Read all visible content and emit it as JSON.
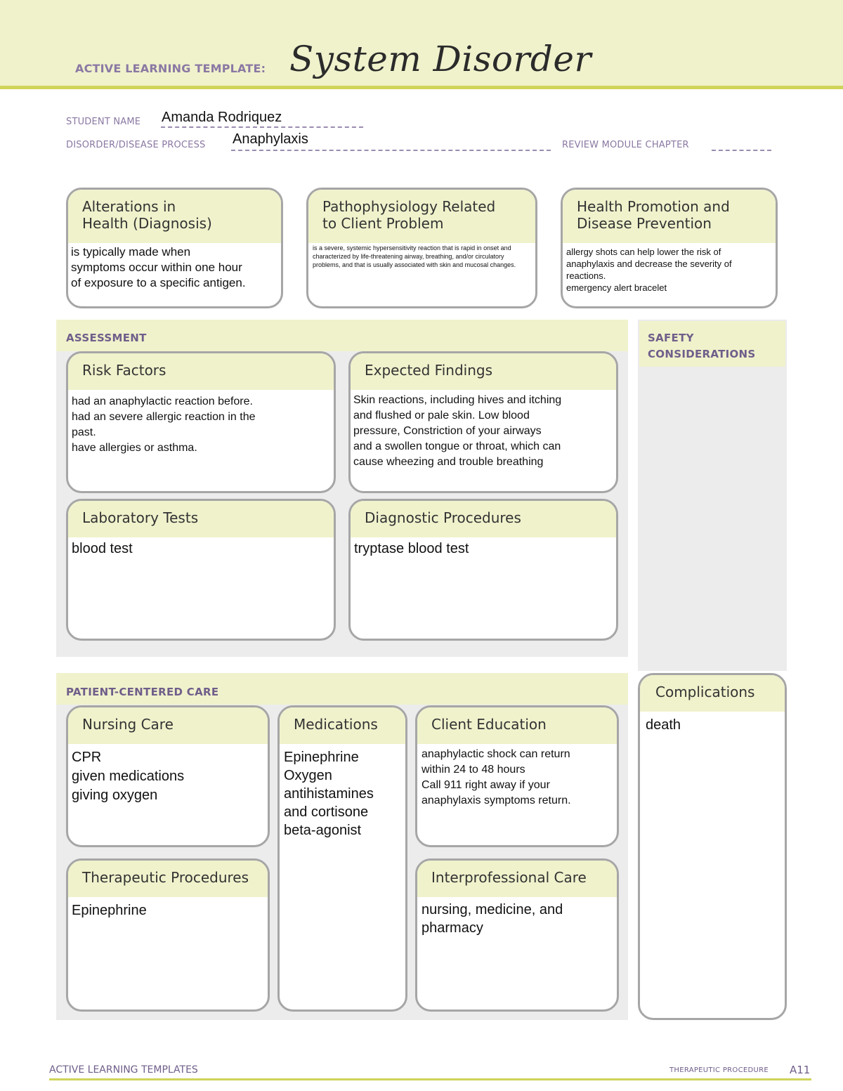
{
  "header": {
    "label": "ACTIVE LEARNING TEMPLATE:",
    "title": "System Disorder"
  },
  "fields": {
    "student_name_label": "STUDENT NAME",
    "student_name_value": "Amanda Rodriquez",
    "disorder_label": "DISORDER/DISEASE PROCESS",
    "disorder_value": "Anaphylaxis",
    "review_module_label": "REVIEW MODULE CHAPTER",
    "review_module_value": ""
  },
  "top_boxes": {
    "alterations": {
      "title": "Alterations in\nHealth (Diagnosis)",
      "body": "is typically made when\nsymptoms occur within one hour\nof exposure to a specific antigen."
    },
    "pathophysiology": {
      "title": "Pathophysiology Related\nto Client Problem",
      "body": "is a severe, systemic hypersensitivity reaction that is rapid in onset and characterized by life-threatening airway, breathing, and/or circulatory problems, and that is usually associated with skin and mucosal changes."
    },
    "health_promotion": {
      "title": "Health Promotion and\nDisease Prevention",
      "body": " allergy shots can help lower the risk of\nanaphylaxis and decrease the severity of\nreactions.\n emergency alert bracelet"
    }
  },
  "assessment": {
    "label": "ASSESSMENT",
    "risk_factors": {
      "title": "Risk Factors",
      "body": "had an anaphylactic reaction before.\n had an severe allergic reaction in the\npast.\n have allergies or asthma."
    },
    "expected_findings": {
      "title": "Expected Findings",
      "body": "Skin reactions, including hives and itching\nand flushed or pale skin. Low blood\npressure, Constriction of your airways\nand a swollen tongue or throat, which can\ncause wheezing and trouble breathing"
    },
    "laboratory_tests": {
      "title": "Laboratory Tests",
      "body": "blood test"
    },
    "diagnostic_procedures": {
      "title": "Diagnostic Procedures",
      "body": "tryptase blood test"
    }
  },
  "safety": {
    "label": "SAFETY\nCONSIDERATIONS",
    "body": ""
  },
  "patient_care": {
    "label": "PATIENT-CENTERED CARE",
    "nursing_care": {
      "title": "Nursing Care",
      "body": "CPR\ngiven medications\ngiving oxygen"
    },
    "medications": {
      "title": "Medications",
      "body": "Epinephrine\nOxygen\nantihistamines\nand cortisone\n beta-agonist"
    },
    "client_education": {
      "title": "Client Education",
      "body": "anaphylactic shock can return\nwithin 24 to 48 hours\nCall 911 right away if your\nanaphylaxis symptoms return."
    },
    "therapeutic_procedures": {
      "title": "Therapeutic Procedures",
      "body": "Epinephrine"
    },
    "interprofessional_care": {
      "title": "Interprofessional Care",
      "body": "nursing, medicine, and\npharmacy"
    }
  },
  "complications": {
    "title": "Complications",
    "body": "death"
  },
  "footer": {
    "left": "ACTIVE LEARNING TEMPLATES",
    "right_label": "THERAPEUTIC PROCEDURE",
    "page": "A11"
  },
  "colors": {
    "header_band": "#f0f2cc",
    "accent_rule": "#cfd45a",
    "label_purple": "#8a78a3",
    "section_purple": "#6f5e8a",
    "section_gray": "#ececec",
    "box_border": "#a6a6a6"
  }
}
